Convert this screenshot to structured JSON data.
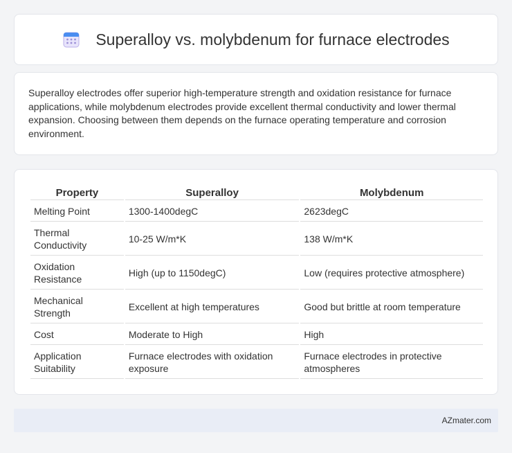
{
  "header": {
    "title": "Superalloy vs. molybdenum for furnace electrodes",
    "icon": "calendar-icon"
  },
  "intro": {
    "text": "Superalloy electrodes offer superior high-temperature strength and oxidation resistance for furnace applications, while molybdenum electrodes provide excellent thermal conductivity and lower thermal expansion. Choosing between them depends on the furnace operating temperature and corrosion environment."
  },
  "table": {
    "headers": [
      "Property",
      "Superalloy",
      "Molybdenum"
    ],
    "rows": [
      [
        "Melting Point",
        "1300-1400degC",
        "2623degC"
      ],
      [
        "Thermal Conductivity",
        "10-25 W/m*K",
        "138 W/m*K"
      ],
      [
        "Oxidation Resistance",
        "High (up to 1150degC)",
        "Low (requires protective atmosphere)"
      ],
      [
        "Mechanical Strength",
        "Excellent at high temperatures",
        "Good but brittle at room temperature"
      ],
      [
        "Cost",
        "Moderate to High",
        "High"
      ],
      [
        "Application Suitability",
        "Furnace electrodes with oxidation exposure",
        "Furnace electrodes in protective atmospheres"
      ]
    ]
  },
  "footer": {
    "brand": "AZmater.com"
  },
  "colors": {
    "page_background": "#f3f4f6",
    "card_background": "#ffffff",
    "footer_background": "#e9edf6",
    "icon_purple": "#9b8fd6",
    "icon_blue": "#4a8df0",
    "text": "#333333"
  }
}
